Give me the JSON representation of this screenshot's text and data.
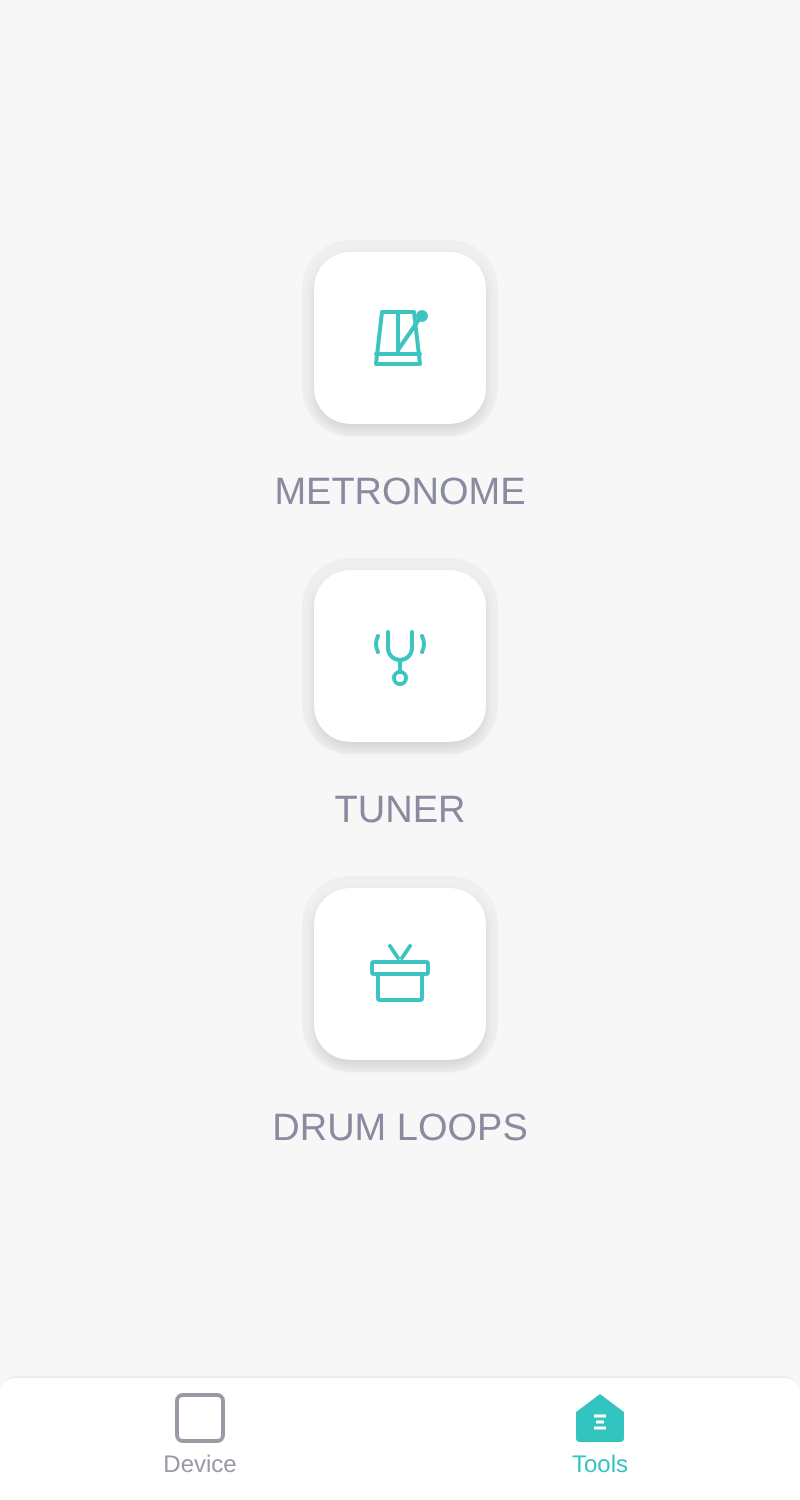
{
  "tools": [
    {
      "kind": "metronome",
      "label": "METRONOME"
    },
    {
      "kind": "tuner",
      "label": "TUNER"
    },
    {
      "kind": "drum",
      "label": "DRUM LOOPS"
    }
  ],
  "nav": [
    {
      "kind": "device",
      "label": "Device",
      "selected": false
    },
    {
      "kind": "tools",
      "label": "Tools",
      "selected": true
    }
  ]
}
